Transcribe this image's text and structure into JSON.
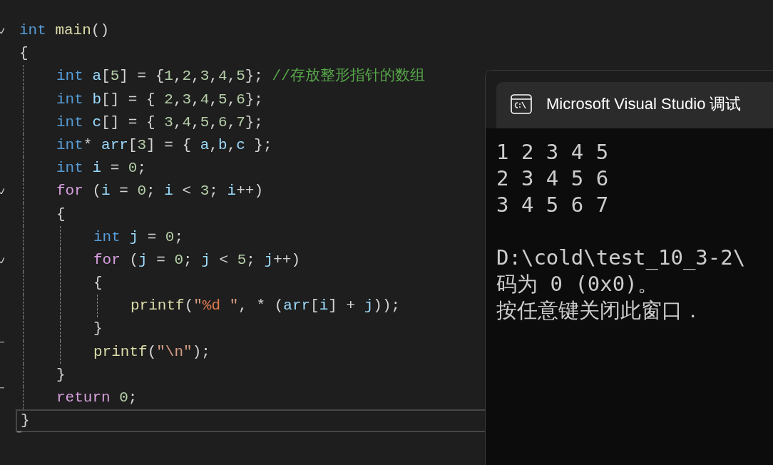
{
  "editor": {
    "lines": [
      {
        "current": false,
        "kind": "fold_start",
        "tokens": [
          {
            "kind": "type",
            "t": "int"
          },
          {
            "kind": "func",
            "t": " main"
          },
          {
            "kind": "punct",
            "t": "()"
          }
        ]
      },
      {
        "current": false,
        "kind": "code",
        "tokens": [
          {
            "kind": "punct",
            "t": "{"
          }
        ]
      },
      {
        "children": [
          {
            "current": false,
            "kind": "code",
            "tokens": [
              {
                "kind": "type",
                "t": "int"
              },
              {
                "kind": "var",
                "t": " a"
              },
              {
                "kind": "punct",
                "t": "["
              },
              {
                "kind": "num",
                "t": "5"
              },
              {
                "kind": "punct",
                "t": "] = {"
              },
              {
                "kind": "num",
                "t": "1"
              },
              {
                "kind": "punct",
                "t": ","
              },
              {
                "kind": "num",
                "t": "2"
              },
              {
                "kind": "punct",
                "t": ","
              },
              {
                "kind": "num",
                "t": "3"
              },
              {
                "kind": "punct",
                "t": ","
              },
              {
                "kind": "num",
                "t": "4"
              },
              {
                "kind": "punct",
                "t": ","
              },
              {
                "kind": "num",
                "t": "5"
              },
              {
                "kind": "punct",
                "t": "};"
              },
              {
                "kind": "comment",
                "t": " //存放整形指针的数组"
              }
            ]
          },
          {
            "current": false,
            "kind": "code",
            "tokens": [
              {
                "kind": "type",
                "t": "int"
              },
              {
                "kind": "var",
                "t": " b"
              },
              {
                "kind": "punct",
                "t": "[] = {"
              },
              {
                "kind": "num",
                "t": " 2"
              },
              {
                "kind": "punct",
                "t": ","
              },
              {
                "kind": "num",
                "t": "3"
              },
              {
                "kind": "punct",
                "t": ","
              },
              {
                "kind": "num",
                "t": "4"
              },
              {
                "kind": "punct",
                "t": ","
              },
              {
                "kind": "num",
                "t": "5"
              },
              {
                "kind": "punct",
                "t": ","
              },
              {
                "kind": "num",
                "t": "6"
              },
              {
                "kind": "punct",
                "t": "};"
              }
            ]
          },
          {
            "current": false,
            "kind": "code",
            "tokens": [
              {
                "kind": "type",
                "t": "int"
              },
              {
                "kind": "var",
                "t": " c"
              },
              {
                "kind": "punct",
                "t": "[] = {"
              },
              {
                "kind": "num",
                "t": " 3"
              },
              {
                "kind": "punct",
                "t": ","
              },
              {
                "kind": "num",
                "t": "4"
              },
              {
                "kind": "punct",
                "t": ","
              },
              {
                "kind": "num",
                "t": "5"
              },
              {
                "kind": "punct",
                "t": ","
              },
              {
                "kind": "num",
                "t": "6"
              },
              {
                "kind": "punct",
                "t": ","
              },
              {
                "kind": "num",
                "t": "7"
              },
              {
                "kind": "punct",
                "t": "};"
              }
            ]
          },
          {
            "current": false,
            "kind": "code",
            "tokens": [
              {
                "kind": "type",
                "t": "int"
              },
              {
                "kind": "punct",
                "t": "*"
              },
              {
                "kind": "var",
                "t": " arr"
              },
              {
                "kind": "punct",
                "t": "["
              },
              {
                "kind": "num",
                "t": "3"
              },
              {
                "kind": "punct",
                "t": "] = {"
              },
              {
                "kind": "var",
                "t": " a"
              },
              {
                "kind": "punct",
                "t": ","
              },
              {
                "kind": "var",
                "t": "b"
              },
              {
                "kind": "punct",
                "t": ","
              },
              {
                "kind": "var",
                "t": "c"
              },
              {
                "kind": "punct",
                "t": " };"
              }
            ]
          },
          {
            "current": false,
            "kind": "code",
            "tokens": [
              {
                "kind": "type",
                "t": "int"
              },
              {
                "kind": "var",
                "t": " i"
              },
              {
                "kind": "punct",
                "t": " ="
              },
              {
                "kind": "num",
                "t": " 0"
              },
              {
                "kind": "punct",
                "t": ";"
              }
            ]
          },
          {
            "current": false,
            "kind": "fold_start",
            "tokens": [
              {
                "kind": "control",
                "t": "for"
              },
              {
                "kind": "punct",
                "t": " ("
              },
              {
                "kind": "var",
                "t": "i"
              },
              {
                "kind": "punct",
                "t": " ="
              },
              {
                "kind": "num",
                "t": " 0"
              },
              {
                "kind": "punct",
                "t": ";"
              },
              {
                "kind": "var",
                "t": " i"
              },
              {
                "kind": "punct",
                "t": " <"
              },
              {
                "kind": "num",
                "t": " 3"
              },
              {
                "kind": "punct",
                "t": ";"
              },
              {
                "kind": "var",
                "t": " i"
              },
              {
                "kind": "punct",
                "t": "++)"
              }
            ]
          },
          {
            "current": false,
            "kind": "code",
            "tokens": [
              {
                "kind": "punct",
                "t": "{"
              }
            ]
          },
          {
            "children": [
              {
                "current": false,
                "kind": "code",
                "tokens": [
                  {
                    "kind": "type",
                    "t": "int"
                  },
                  {
                    "kind": "var",
                    "t": " j"
                  },
                  {
                    "kind": "punct",
                    "t": " ="
                  },
                  {
                    "kind": "num",
                    "t": " 0"
                  },
                  {
                    "kind": "punct",
                    "t": ";"
                  }
                ]
              },
              {
                "current": false,
                "kind": "fold_start",
                "tokens": [
                  {
                    "kind": "control",
                    "t": "for"
                  },
                  {
                    "kind": "punct",
                    "t": " ("
                  },
                  {
                    "kind": "var",
                    "t": "j"
                  },
                  {
                    "kind": "punct",
                    "t": " ="
                  },
                  {
                    "kind": "num",
                    "t": " 0"
                  },
                  {
                    "kind": "punct",
                    "t": ";"
                  },
                  {
                    "kind": "var",
                    "t": " j"
                  },
                  {
                    "kind": "punct",
                    "t": " <"
                  },
                  {
                    "kind": "num",
                    "t": " 5"
                  },
                  {
                    "kind": "punct",
                    "t": ";"
                  },
                  {
                    "kind": "var",
                    "t": " j"
                  },
                  {
                    "kind": "punct",
                    "t": "++)"
                  }
                ]
              },
              {
                "current": false,
                "kind": "code",
                "tokens": [
                  {
                    "kind": "punct",
                    "t": "{"
                  }
                ]
              },
              {
                "children": [
                  {
                    "current": false,
                    "tokens": [
                      {
                        "kind": "func",
                        "t": "printf"
                      },
                      {
                        "kind": "punct",
                        "t": "("
                      },
                      {
                        "kind": "string",
                        "t": "\""
                      },
                      {
                        "kind": "format",
                        "t": "%d"
                      },
                      {
                        "kind": "string",
                        "t": " \""
                      },
                      {
                        "kind": "punct",
                        "t": ", * ("
                      },
                      {
                        "kind": "var",
                        "t": "arr"
                      },
                      {
                        "kind": "punct",
                        "t": "["
                      },
                      {
                        "kind": "var",
                        "t": "i"
                      },
                      {
                        "kind": "punct",
                        "t": "] +"
                      },
                      {
                        "kind": "var",
                        "t": " j"
                      },
                      {
                        "kind": "punct",
                        "t": "));"
                      }
                    ]
                  }
                ]
              },
              {
                "current": false,
                "kind": "fold_end",
                "tokens": [
                  {
                    "kind": "punct",
                    "t": "}"
                  }
                ]
              },
              {
                "current": false,
                "kind": "code",
                "tokens": [
                  {
                    "kind": "func",
                    "t": "printf"
                  },
                  {
                    "kind": "punct",
                    "t": "("
                  },
                  {
                    "kind": "string",
                    "t": "\"\\n\""
                  },
                  {
                    "kind": "punct",
                    "t": ");"
                  }
                ]
              }
            ]
          },
          {
            "current": false,
            "kind": "fold_end",
            "tokens": [
              {
                "kind": "punct",
                "t": "}"
              }
            ]
          },
          {
            "current": false,
            "kind": "code",
            "tokens": [
              {
                "kind": "control",
                "t": "return"
              },
              {
                "kind": "num",
                "t": " 0"
              },
              {
                "kind": "punct",
                "t": ";"
              }
            ]
          }
        ]
      },
      {
        "current": true,
        "kind": "fold_end",
        "tokens": [
          {
            "kind": "punct",
            "t": "}"
          }
        ]
      }
    ]
  },
  "console": {
    "title": "Microsoft Visual Studio 调试",
    "output": [
      "1 2 3 4 5",
      "2 3 4 5 6",
      "3 4 5 6 7"
    ],
    "messages": [
      "D:\\cold\\test_10_3-2\\",
      "码为 0 (0x0)。",
      "按任意键关闭此窗口．"
    ]
  }
}
